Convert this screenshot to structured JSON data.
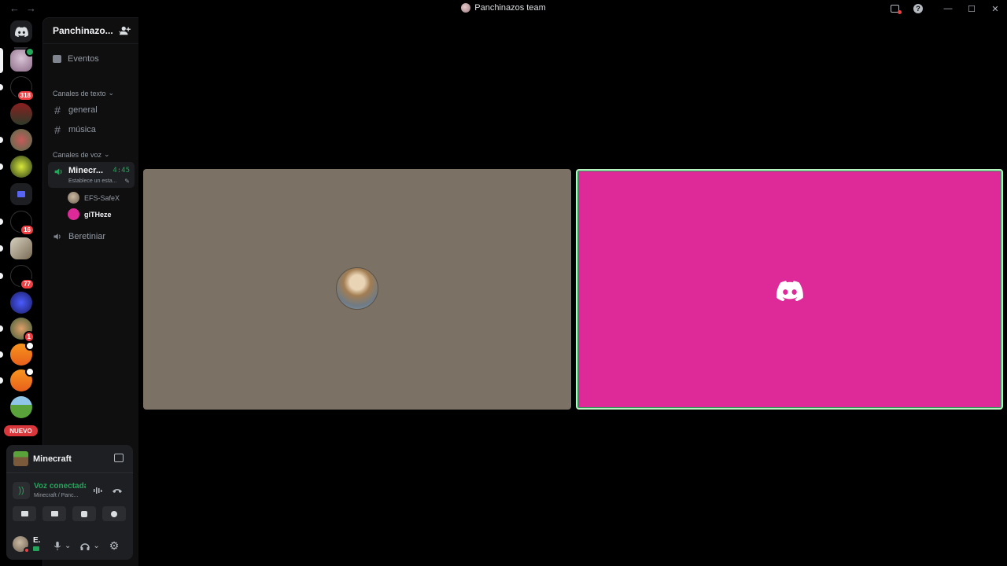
{
  "window": {
    "title": "Panchinazos team",
    "nav_back": "←",
    "nav_forward": "→",
    "help": "?",
    "minimize": "—",
    "maximize": "☐",
    "close": "✕"
  },
  "rail": {
    "badges": {
      "s2": "318",
      "s7": "16",
      "s9": "77",
      "s11": "1"
    },
    "nuevo_label": "NUEVO"
  },
  "guild": {
    "name": "Panchinazo...",
    "chevron": "⌄",
    "events_label": "Eventos",
    "text_category": "Canales de texto",
    "voice_category": "Canales de voz",
    "text_channels": [
      "general",
      "música"
    ],
    "hash": "#",
    "voice_active": {
      "name": "Minecr...",
      "timer": "4:45",
      "status": "Establece un esta...",
      "edit": "✎"
    },
    "members": [
      "EFS-SafeX",
      "giTHeze"
    ],
    "other_voice": "Beretiniar"
  },
  "activity": {
    "game": "Minecraft"
  },
  "voice_connection": {
    "title": "Voz conectada",
    "subtitle": "Minecraft / Panc...",
    "signal_glyph": "))"
  },
  "user": {
    "name": "E.",
    "mic_chevron": "⌄",
    "headset_chevron": "⌄",
    "gear": "⚙"
  },
  "colors": {
    "accent_green": "#23a55a",
    "tile_left": "#7b7164",
    "tile_right": "#dd2a98",
    "badge_red": "#f23f43"
  }
}
